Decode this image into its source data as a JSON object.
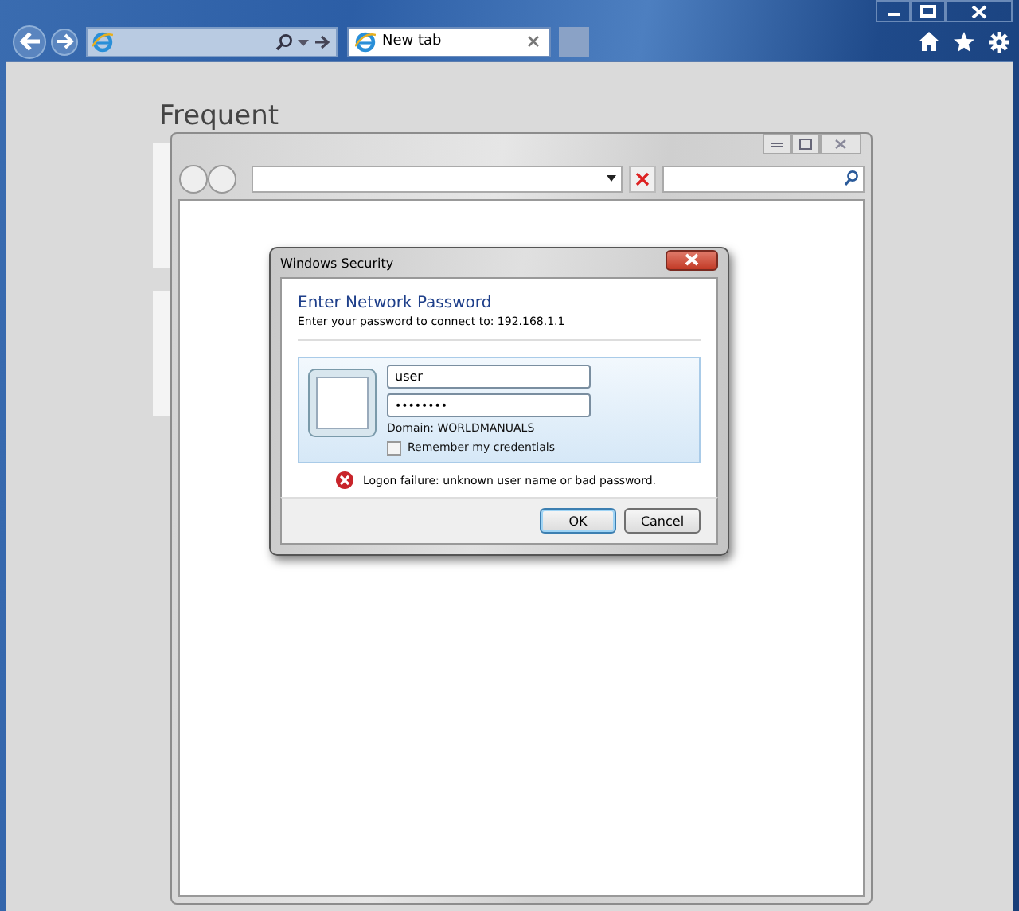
{
  "browser": {
    "tabs": [
      {
        "label": "New tab",
        "selected": true
      }
    ]
  },
  "page": {
    "heading": "Frequent"
  },
  "dialog": {
    "title": "Windows Security",
    "heading": "Enter Network Password",
    "prompt": "Enter your password to connect to: 192.168.1.1",
    "username": {
      "value": "user"
    },
    "password": {
      "value": "••••••••"
    },
    "domain": "Domain: WORLDMANUALS",
    "remember": {
      "label": "Remember my credentials",
      "checked": false
    },
    "error": "Logon failure: unknown user name or bad password.",
    "buttons": [
      {
        "label": "OK",
        "default": true
      },
      {
        "label": "Cancel",
        "default": false
      }
    ]
  }
}
